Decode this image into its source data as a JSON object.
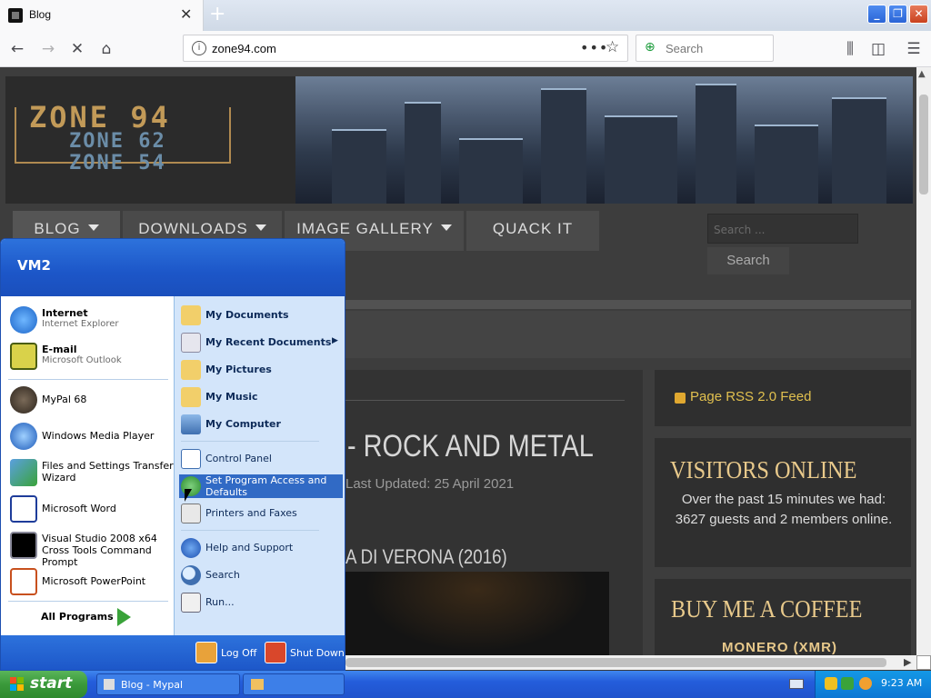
{
  "browser": {
    "tab_title": "Blog",
    "new_tab_label": "+",
    "url": "zone94.com",
    "search_placeholder": "Search"
  },
  "site": {
    "logo_main": "ZONE 94",
    "logo_sub1": "ZONE 62",
    "logo_sub2": "ZONE 54",
    "nav": [
      {
        "label": "BLOG"
      },
      {
        "label": "DOWNLOADS"
      },
      {
        "label": "IMAGE GALLERY"
      },
      {
        "label": "QUACK IT"
      }
    ],
    "search_placeholder": "Search ...",
    "search_button": "Search",
    "article_title": "- ROCK AND METAL",
    "article_updated": "Last Updated: 25 April 2021",
    "article_subtitle": "A DI VERONA (2016)",
    "rss_label": "Page RSS 2.0 Feed",
    "visitors_heading": "VISITORS ONLINE",
    "visitors_text": "Over the past 15 minutes we had: 3627 guests and 2 members online.",
    "coffee_heading": "BUY ME A COFFEE",
    "coffee_sub": "MONERO (XMR)"
  },
  "start_menu": {
    "user": "VM2",
    "pinned": [
      {
        "title": "Internet",
        "subtitle": "Internet Explorer",
        "icon": "ie-icon"
      },
      {
        "title": "E-mail",
        "subtitle": "Microsoft Outlook",
        "icon": "outlook-icon"
      }
    ],
    "recent": [
      {
        "title": "MyPal 68",
        "icon": "mypal-icon"
      },
      {
        "title": "Windows Media Player",
        "icon": "media-player-icon"
      },
      {
        "title": "Files and Settings Transfer Wizard",
        "icon": "transfer-wizard-icon"
      },
      {
        "title": "Microsoft Word",
        "icon": "word-icon"
      },
      {
        "title": "Visual Studio 2008 x64 Cross Tools Command Prompt",
        "icon": "cmd-icon"
      },
      {
        "title": "Microsoft PowerPoint",
        "icon": "powerpoint-icon"
      }
    ],
    "all_programs": "All Programs",
    "places": [
      {
        "title": "My Documents"
      },
      {
        "title": "My Recent Documents"
      },
      {
        "title": "My Pictures"
      },
      {
        "title": "My Music"
      },
      {
        "title": "My Computer"
      }
    ],
    "system": [
      {
        "title": "Control Panel"
      },
      {
        "title": "Set Program Access and Defaults"
      },
      {
        "title": "Printers and Faxes"
      }
    ],
    "help": [
      {
        "title": "Help and Support"
      },
      {
        "title": "Search"
      },
      {
        "title": "Run..."
      }
    ],
    "log_off": "Log Off",
    "shut_down": "Shut Down"
  },
  "taskbar": {
    "start_label": "start",
    "task_blog": "Blog - Mypal",
    "clock": "9:23 AM"
  },
  "colors": {
    "xp_blue": "#245ddb",
    "start_green": "#3a993a",
    "highlight": "#316ac5",
    "heading_gold": "#e8c98b"
  }
}
